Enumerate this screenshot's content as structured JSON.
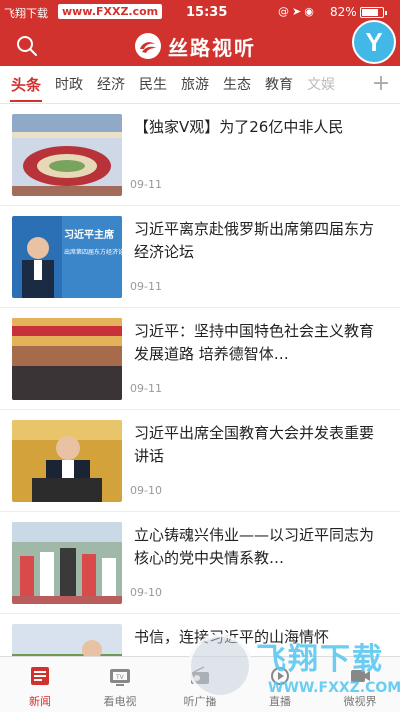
{
  "status_bar": {
    "carrier": "飞翔下载",
    "site": "www.FXXZ.com",
    "time": "15:35",
    "battery": "82%",
    "battery_level": 0.82
  },
  "header": {
    "app_name": "丝路视听",
    "avatar_letter": "Y"
  },
  "tabs": [
    "头条",
    "时政",
    "经济",
    "民生",
    "旅游",
    "生态",
    "教育",
    "文娱"
  ],
  "active_tab": "头条",
  "news": [
    {
      "title": "【独家V观】为了26亿中非人民",
      "date": "09-11"
    },
    {
      "title": "习近平离京赴俄罗斯出席第四届东方经济论坛",
      "date": "09-11",
      "thumb_text": "习近平主席",
      "thumb_sub": "出席第四届东方经济论坛"
    },
    {
      "title": "习近平：坚持中国特色社会主义教育发展道路 培养德智体…",
      "date": "09-11"
    },
    {
      "title": "习近平出席全国教育大会并发表重要讲话",
      "date": "09-10"
    },
    {
      "title": "立心铸魂兴伟业——以习近平同志为核心的党中央情系教…",
      "date": "09-10"
    },
    {
      "title": "书信，连接习近平的山海情怀",
      "date": ""
    }
  ],
  "bottom_nav": [
    {
      "label": "新闻",
      "icon": "news-icon"
    },
    {
      "label": "看电视",
      "icon": "tv-icon"
    },
    {
      "label": "听广播",
      "icon": "radio-icon"
    },
    {
      "label": "直播",
      "icon": "live-icon"
    },
    {
      "label": "微视界",
      "icon": "video-icon"
    }
  ],
  "watermark": {
    "title": "飞翔下载",
    "url": "WWW.FXXZ.COM"
  },
  "colors": {
    "brand": "#d2322d",
    "avatar": "#42b8e6"
  }
}
